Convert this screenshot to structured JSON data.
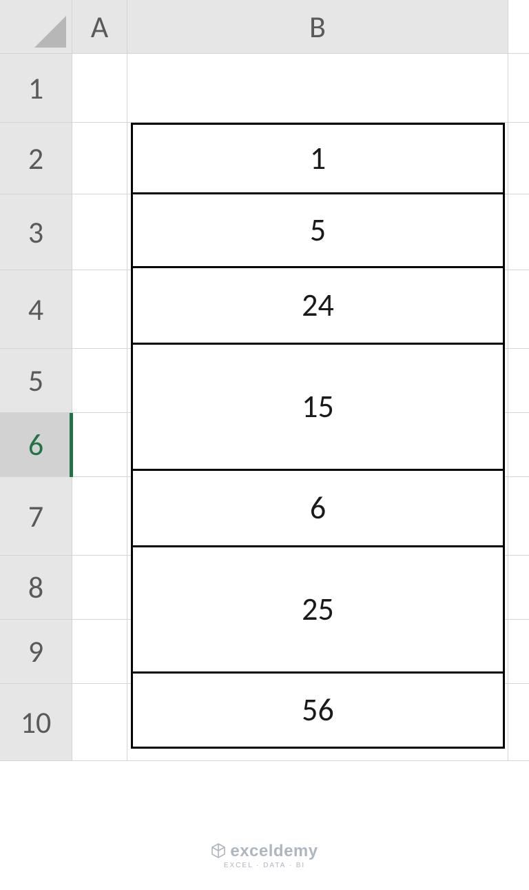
{
  "columns": {
    "A": "A",
    "B": "B"
  },
  "rows": {
    "r1": "1",
    "r2": "2",
    "r3": "3",
    "r4": "4",
    "r5": "5",
    "r6": "6",
    "r7": "7",
    "r8": "8",
    "r9": "9",
    "r10": "10"
  },
  "active_row": "6",
  "cells": {
    "b2": "1",
    "b3": "5",
    "b4": "24",
    "b5_merged": "15",
    "b7": "6",
    "b8_merged": "25",
    "b10": "56"
  },
  "row_heights": {
    "r1": 100,
    "r2": 104,
    "r3": 110,
    "r4": 114,
    "r5": 93,
    "r6": 93,
    "r7": 114,
    "r8": 93,
    "r9": 93,
    "r10": 112
  },
  "data_heights": {
    "b2": 104,
    "b3": 110,
    "b4": 114,
    "b5_merged": 186,
    "b7": 114,
    "b8_merged": 186,
    "b10": 112
  },
  "watermark": {
    "brand": "exceldemy",
    "tagline": "EXCEL · DATA · BI"
  }
}
